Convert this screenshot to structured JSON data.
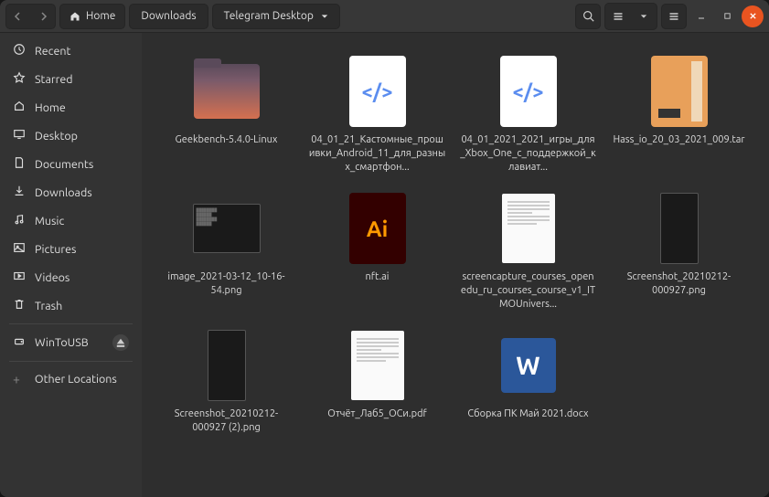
{
  "breadcrumb": {
    "home": "Home",
    "parts": [
      "Downloads",
      "Telegram Desktop"
    ]
  },
  "sidebar": {
    "items": [
      {
        "icon": "clock",
        "label": "Recent"
      },
      {
        "icon": "star",
        "label": "Starred"
      },
      {
        "icon": "home",
        "label": "Home"
      },
      {
        "icon": "desktop",
        "label": "Desktop"
      },
      {
        "icon": "doc",
        "label": "Documents"
      },
      {
        "icon": "download",
        "label": "Downloads"
      },
      {
        "icon": "music",
        "label": "Music"
      },
      {
        "icon": "picture",
        "label": "Pictures"
      },
      {
        "icon": "video",
        "label": "Videos"
      },
      {
        "icon": "trash",
        "label": "Trash"
      }
    ],
    "mounts": [
      {
        "icon": "disk",
        "label": "WinToUSB",
        "eject": true
      }
    ],
    "other": "Other Locations"
  },
  "files": [
    {
      "type": "folder",
      "name": "Geekbench-5.4.0-Linux"
    },
    {
      "type": "code",
      "name": "04_01_21_Кастомные_прошивки_Android_11_для_разных_смартфон..."
    },
    {
      "type": "code",
      "name": "04_01_2021_2021_игры_для_Xbox_One_с_поддержкой_клавиат..."
    },
    {
      "type": "tar",
      "name": "Hass_io_20_03_2021_009.tar"
    },
    {
      "type": "img",
      "name": "image_2021-03-12_10-16-54.png"
    },
    {
      "type": "ai",
      "name": "nft.ai"
    },
    {
      "type": "doc",
      "name": "screencapture_courses_openedu_ru_courses_course_v1_ITMOUnivers..."
    },
    {
      "type": "imgTall",
      "name": "Screenshot_20210212-000927.png"
    },
    {
      "type": "imgTall",
      "name": "Screenshot_20210212-000927 (2).png"
    },
    {
      "type": "doc",
      "name": "Отчёт_Лаб5_ОСи.pdf"
    },
    {
      "type": "word",
      "name": "Сборка ПК Май 2021.docx"
    }
  ]
}
